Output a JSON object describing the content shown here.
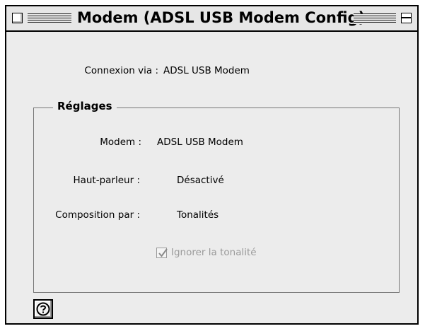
{
  "window": {
    "title": "Modem (ADSL USB Modem Config)"
  },
  "connexion": {
    "label": "Connexion via :",
    "value": "ADSL USB Modem"
  },
  "reglages": {
    "title": "Réglages",
    "modem": {
      "label": "Modem :",
      "value": "ADSL USB Modem"
    },
    "haut_parleur": {
      "label": "Haut-parleur :",
      "value": "Désactivé"
    },
    "composition": {
      "label": "Composition par :",
      "value": "Tonalités"
    },
    "ignorer_tonalite": {
      "label": "Ignorer la tonalité",
      "checked": true,
      "disabled": true
    }
  },
  "icons": {
    "close": "close-box-icon",
    "zoom": "zoom-box-icon",
    "help": "help-icon",
    "check": "checkmark-icon"
  },
  "colors": {
    "window_bg": "#ececec",
    "disabled_text": "#9a9a9a"
  }
}
